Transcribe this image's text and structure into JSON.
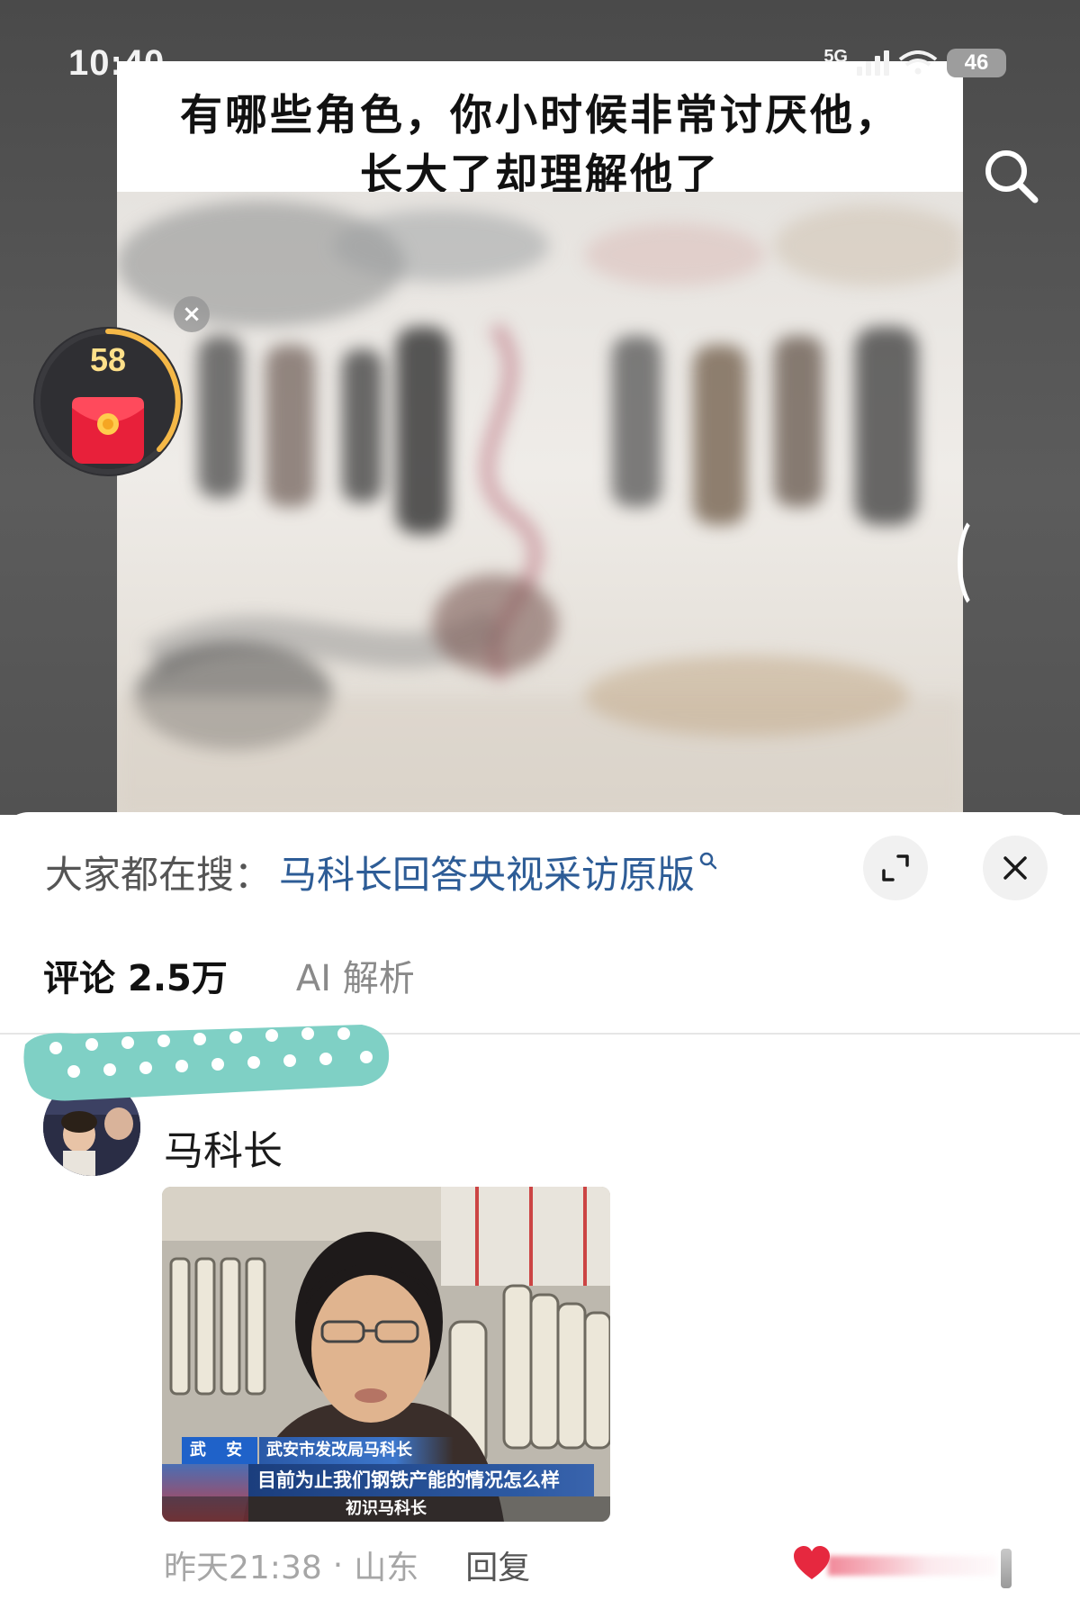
{
  "status_bar": {
    "time": "10:40",
    "network": "5G",
    "battery": "46"
  },
  "post": {
    "title_line1": "有哪些角色，你小时候非常讨厌他，",
    "title_line2": "长大了却理解他了"
  },
  "reward": {
    "count": "58",
    "dismiss_symbol": "×"
  },
  "hot_search": {
    "prefix": "大家都在搜：",
    "query": "马科长回答央视采访原版"
  },
  "tabs": [
    {
      "label": "评论",
      "count": "2.5万",
      "active": true
    },
    {
      "label": "AI 解析",
      "active": false
    }
  ],
  "comment": {
    "username": "马科长",
    "image": {
      "place_tag": "武 安",
      "speaker_name": "武安市发改局马科长",
      "quote": "目前为止我们钢铁产能的情况怎么样",
      "caption": "初识马科长"
    },
    "time": "昨天21:38",
    "separator": "·",
    "location": "山东",
    "reply_label": "回复"
  },
  "icons": {
    "search": "search-icon",
    "expand": "expand-icon",
    "close": "close-icon",
    "envelope": "red-envelope-icon",
    "heart": "heart-icon",
    "query_search": "search-icon"
  },
  "colors": {
    "link_blue": "#2d5c96",
    "reward_ring": "#f5b847",
    "envelope_red": "#e8203a",
    "heart_red": "#e6283f"
  }
}
